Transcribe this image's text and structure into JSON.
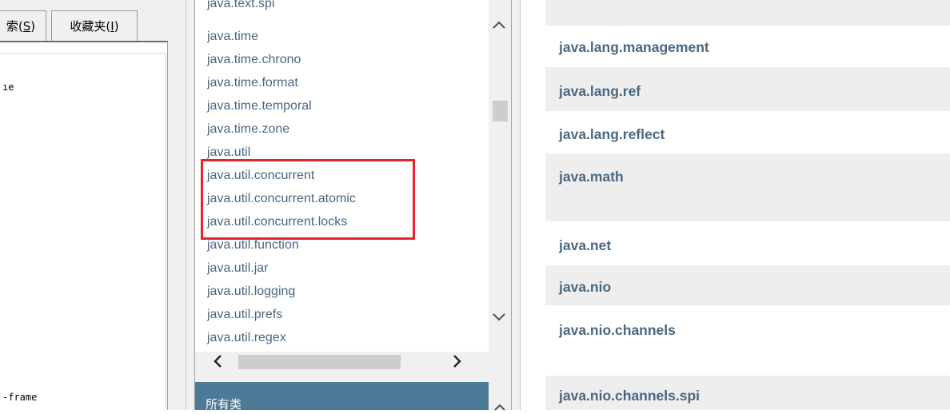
{
  "left_panel": {
    "tabs": [
      {
        "label": "索",
        "mnemonic": "S"
      },
      {
        "label": "收藏夹",
        "mnemonic": "I"
      }
    ],
    "top_text": "ıe",
    "bottom_text": "-frame"
  },
  "package_list": {
    "items": [
      "java.text.spi",
      "java.time",
      "java.time.chrono",
      "java.time.format",
      "java.time.temporal",
      "java.time.zone",
      "java.util",
      "java.util.concurrent",
      "java.util.concurrent.atomic",
      "java.util.concurrent.locks",
      "java.util.function",
      "java.util.jar",
      "java.util.logging",
      "java.util.prefs",
      "java.util.regex"
    ],
    "highlighted": [
      "java.util.concurrent",
      "java.util.concurrent.atomic",
      "java.util.concurrent.locks"
    ],
    "highlight_color": "#e8232d"
  },
  "all_classes": {
    "title": "所有类"
  },
  "overview": {
    "rows": [
      "java.lang.management",
      "java.lang.ref",
      "java.lang.reflect",
      "java.math",
      "java.net",
      "java.nio",
      "java.nio.channels",
      "java.nio.channels.spi"
    ]
  },
  "icons": {
    "scroll_up": "chevron-up-icon",
    "scroll_down": "chevron-down-icon",
    "scroll_left": "chevron-left-icon",
    "scroll_right": "chevron-right-icon"
  },
  "colors": {
    "link": "#4a6782",
    "header_bg": "#4d7a97",
    "row_alt": "#eeeeee"
  }
}
